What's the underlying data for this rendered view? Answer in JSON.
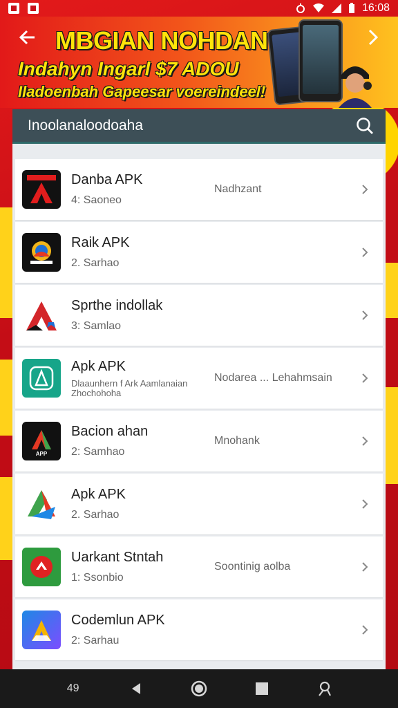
{
  "status_bar": {
    "time": "16:08"
  },
  "banner": {
    "headline": "MBGIAN NOHDAN",
    "subline": "Indahyn Ingarl $7 ADOU",
    "tagline": "Iladoenbah Gapeesar voereindeel!"
  },
  "search": {
    "label": "Inoolanaloodoaha"
  },
  "apps": [
    {
      "name": "Danba APK",
      "sub": "4: Saoneo",
      "status": "Nadhzant",
      "icon_color": "#111111",
      "accent": "#e11d1d"
    },
    {
      "name": "Raik APK",
      "sub": "2. Sarhao",
      "status": "",
      "icon_color": "#111111",
      "accent": "#f2b51a"
    },
    {
      "name": "Sprthe indollak",
      "sub": "3: Samlao",
      "status": "",
      "icon_color": "#ffffff",
      "accent": "#d3262a"
    },
    {
      "name": "Apk APK",
      "sub": "Dlaaunhern f Ark Aamlanaian",
      "sub2": "Zhochohoha",
      "status": "Nodarea ... Lehahmsain",
      "icon_color": "#17a589",
      "accent": "#ffffff"
    },
    {
      "name": "Bacion ahan",
      "sub": "2: Samhao",
      "status": "Mnohank",
      "icon_color": "#111111",
      "accent": "#e53924"
    },
    {
      "name": "Apk APK",
      "sub": "2. Sarhao",
      "status": "",
      "icon_color": "#ffffff",
      "accent": "#1e88e5"
    },
    {
      "name": "Uarkant Stntah",
      "sub": "1: Ssonbio",
      "status": "Soontinig aolba",
      "icon_color": "#2e9b3e",
      "accent": "#e02222"
    },
    {
      "name": "Codemlun APK",
      "sub": "2: Sarhau",
      "status": "",
      "icon_color": "#1e88e5",
      "accent": "#f5b400"
    }
  ],
  "navbar": {
    "left_label": "49"
  }
}
